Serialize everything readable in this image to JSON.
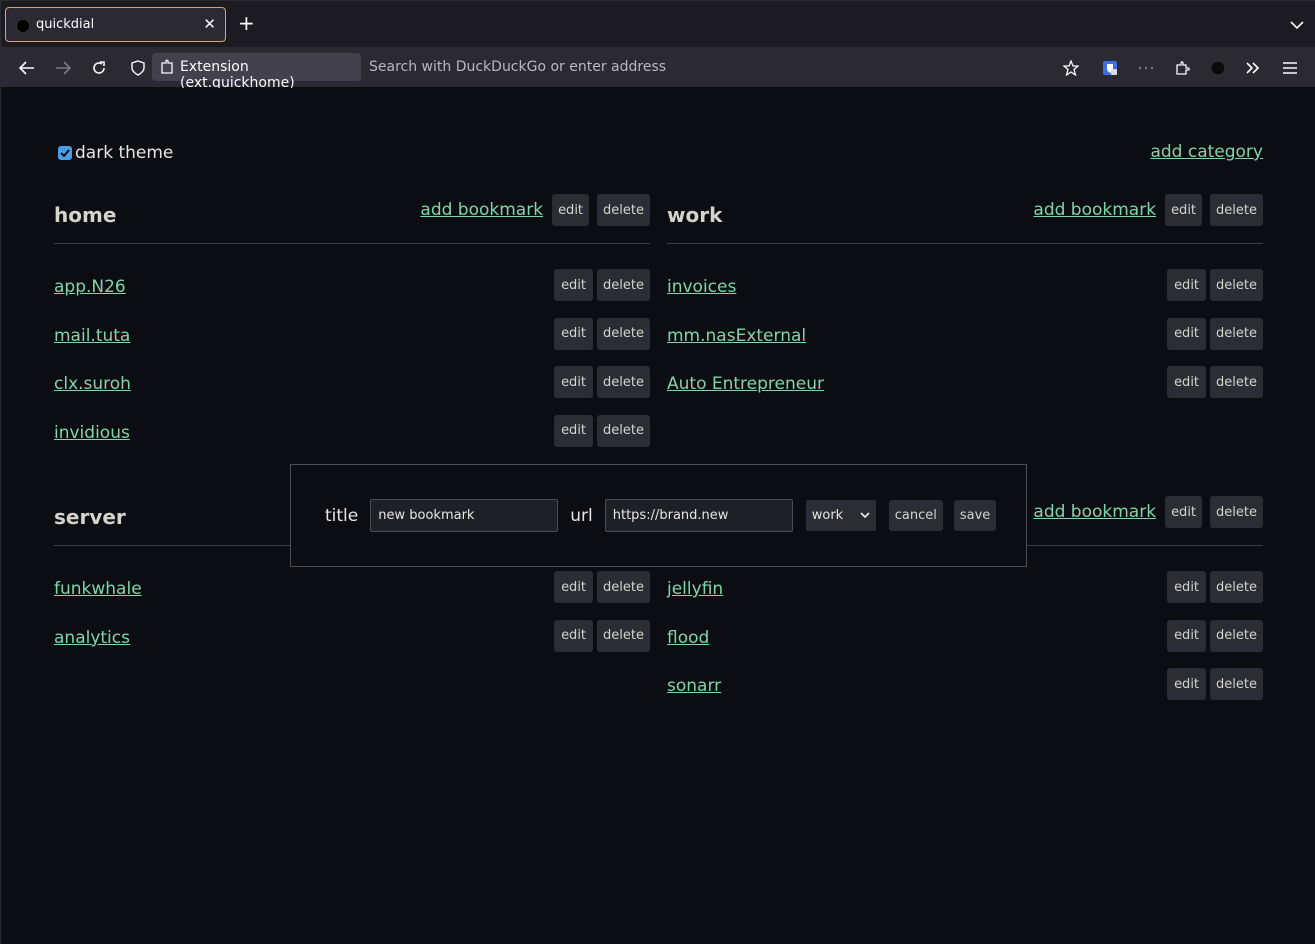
{
  "browser": {
    "tab_title": "quickdial",
    "extension_label": "Extension (ext.quickhome)",
    "url_placeholder": "Search with DuckDuckGo or enter address"
  },
  "page": {
    "theme_label": "dark theme",
    "theme_checked": true,
    "add_category_label": "add category",
    "add_bookmark_label": "add bookmark",
    "edit_label": "edit",
    "delete_label": "delete",
    "categories": [
      {
        "title": "home",
        "bookmarks": [
          "app.N26",
          "mail.tuta",
          "clx.suroh",
          "invidious"
        ]
      },
      {
        "title": "work",
        "bookmarks": [
          "invoices",
          "mm.nasExternal",
          "Auto Entrepreneur"
        ]
      },
      {
        "title": "server",
        "bookmarks": [
          "funkwhale",
          "analytics"
        ]
      },
      {
        "title": "",
        "bookmarks": [
          "jellyfin",
          "flood",
          "sonarr"
        ]
      }
    ]
  },
  "modal": {
    "title_label": "title",
    "title_value": "new bookmark",
    "url_label": "url",
    "url_value": "https://brand.new",
    "category_selected": "work",
    "cancel_label": "cancel",
    "save_label": "save"
  },
  "colors": {
    "link": "#7fd6a8",
    "background": "#0b0d12",
    "button": "#2a2d33",
    "tab_border": "#d4a66a"
  }
}
